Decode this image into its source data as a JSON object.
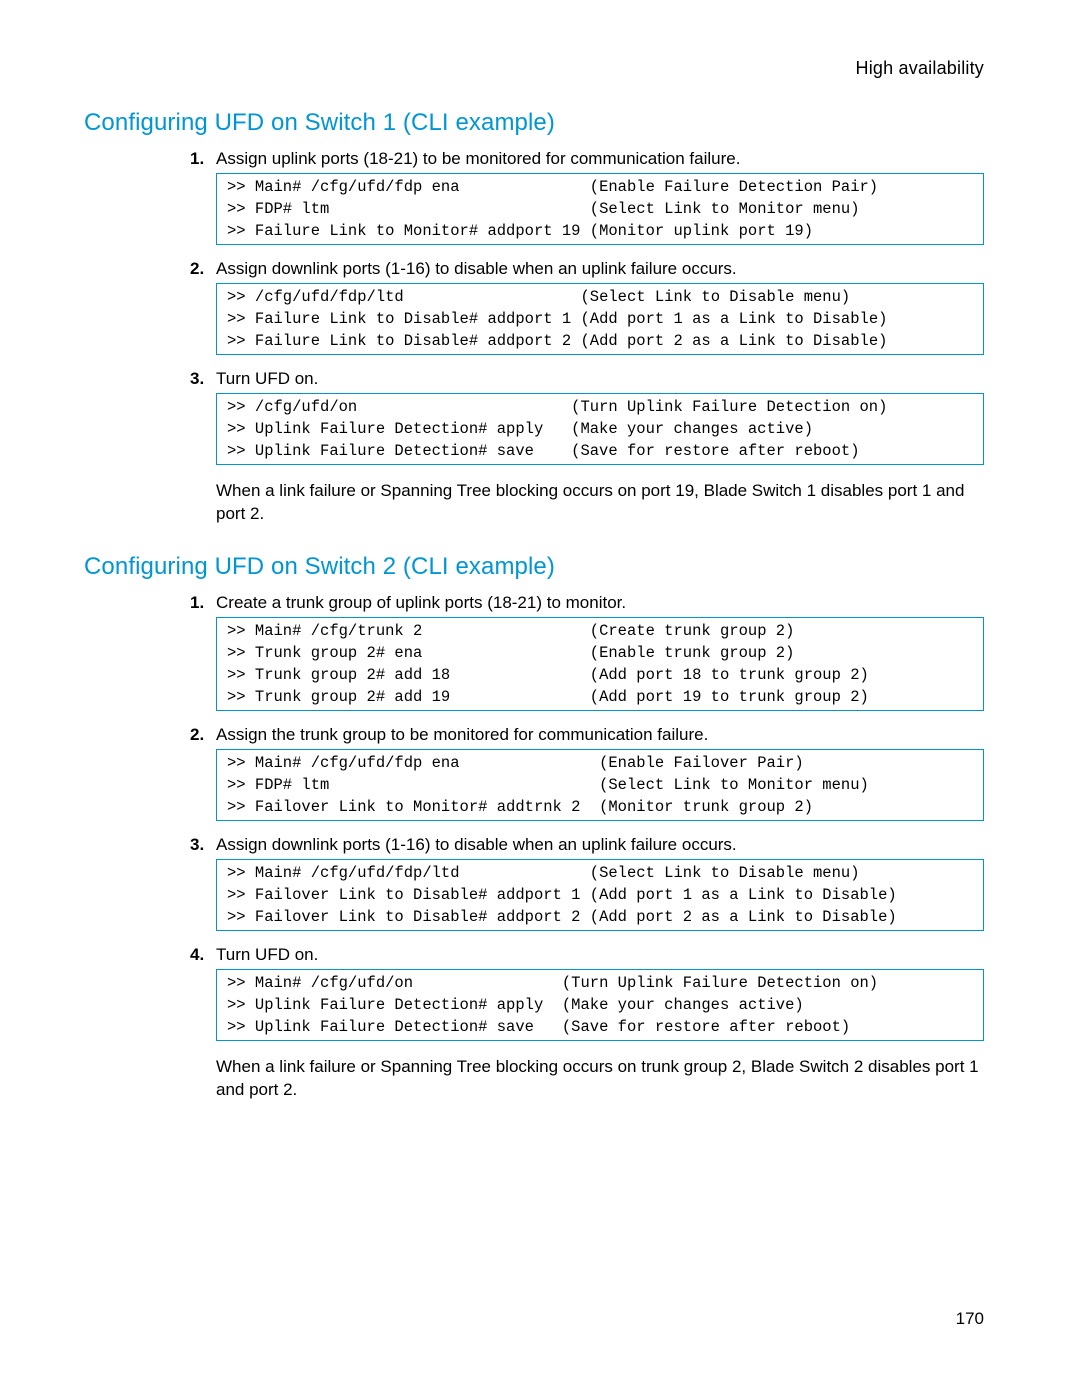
{
  "header": "High availability",
  "pageNumber": "170",
  "section1": {
    "title": "Configuring UFD on Switch 1 (CLI example)",
    "steps": {
      "s1": {
        "num": "1.",
        "text": "Assign uplink ports (18-21) to be monitored for communication failure."
      },
      "s2": {
        "num": "2.",
        "text": "Assign downlink ports (1-16) to disable when an uplink failure occurs."
      },
      "s3": {
        "num": "3.",
        "text": "Turn UFD on."
      }
    },
    "code1": {
      "r1": {
        "cmd": ">> Main# /cfg/ufd/fdp ena              ",
        "desc": "(Enable Failure Detection Pair)"
      },
      "r2": {
        "cmd": ">> FDP# ltm                            ",
        "desc": "(Select Link to Monitor menu)"
      },
      "r3": {
        "cmd": ">> Failure Link to Monitor# addport 19 ",
        "desc": "(Monitor uplink port 19)"
      }
    },
    "code2": {
      "r1": {
        "cmd": ">> /cfg/ufd/fdp/ltd                   ",
        "desc": "(Select Link to Disable menu)"
      },
      "r2": {
        "cmd": ">> Failure Link to Disable# addport 1 ",
        "desc": "(Add port 1 as a Link to Disable)"
      },
      "r3": {
        "cmd": ">> Failure Link to Disable# addport 2 ",
        "desc": "(Add port 2 as a Link to Disable)"
      }
    },
    "code3": {
      "r1": {
        "cmd": ">> /cfg/ufd/on                       ",
        "desc": "(Turn Uplink Failure Detection on)"
      },
      "r2": {
        "cmd": ">> Uplink Failure Detection# apply   ",
        "desc": "(Make your changes active)"
      },
      "r3": {
        "cmd": ">> Uplink Failure Detection# save    ",
        "desc": "(Save for restore after reboot)"
      }
    },
    "para": "When a link failure or Spanning Tree blocking occurs on port 19, Blade Switch 1 disables port 1 and port 2."
  },
  "section2": {
    "title": "Configuring UFD on Switch 2 (CLI example)",
    "steps": {
      "s1": {
        "num": "1.",
        "text": "Create a trunk group of uplink ports (18-21) to monitor."
      },
      "s2": {
        "num": "2.",
        "text": "Assign the trunk group to be monitored for communication failure."
      },
      "s3": {
        "num": "3.",
        "text": "Assign downlink ports (1-16) to disable when an uplink failure occurs."
      },
      "s4": {
        "num": "4.",
        "text": "Turn UFD on."
      }
    },
    "code1": {
      "r1": {
        "cmd": ">> Main# /cfg/trunk 2                  ",
        "desc": "(Create trunk group 2)"
      },
      "r2": {
        "cmd": ">> Trunk group 2# ena                  ",
        "desc": "(Enable trunk group 2)"
      },
      "r3": {
        "cmd": ">> Trunk group 2# add 18               ",
        "desc": "(Add port 18 to trunk group 2)"
      },
      "r4": {
        "cmd": ">> Trunk group 2# add 19               ",
        "desc": "(Add port 19 to trunk group 2)"
      }
    },
    "code2": {
      "r1": {
        "cmd": ">> Main# /cfg/ufd/fdp ena               ",
        "desc": "(Enable Failover Pair)"
      },
      "r2": {
        "cmd": ">> FDP# ltm                             ",
        "desc": "(Select Link to Monitor menu)"
      },
      "r3": {
        "cmd": ">> Failover Link to Monitor# addtrnk 2  ",
        "desc": "(Monitor trunk group 2)"
      }
    },
    "code3": {
      "r1": {
        "cmd": ">> Main# /cfg/ufd/fdp/ltd              ",
        "desc": "(Select Link to Disable menu)"
      },
      "r2": {
        "cmd": ">> Failover Link to Disable# addport 1 ",
        "desc": "(Add port 1 as a Link to Disable)"
      },
      "r3": {
        "cmd": ">> Failover Link to Disable# addport 2 ",
        "desc": "(Add port 2 as a Link to Disable)"
      }
    },
    "code4": {
      "r1": {
        "cmd": ">> Main# /cfg/ufd/on                ",
        "desc": "(Turn Uplink Failure Detection on)"
      },
      "r2": {
        "cmd": ">> Uplink Failure Detection# apply  ",
        "desc": "(Make your changes active)"
      },
      "r3": {
        "cmd": ">> Uplink Failure Detection# save   ",
        "desc": "(Save for restore after reboot)"
      }
    },
    "para": "When a link failure or Spanning Tree blocking occurs on trunk group 2, Blade Switch 2 disables port 1 and port 2."
  }
}
